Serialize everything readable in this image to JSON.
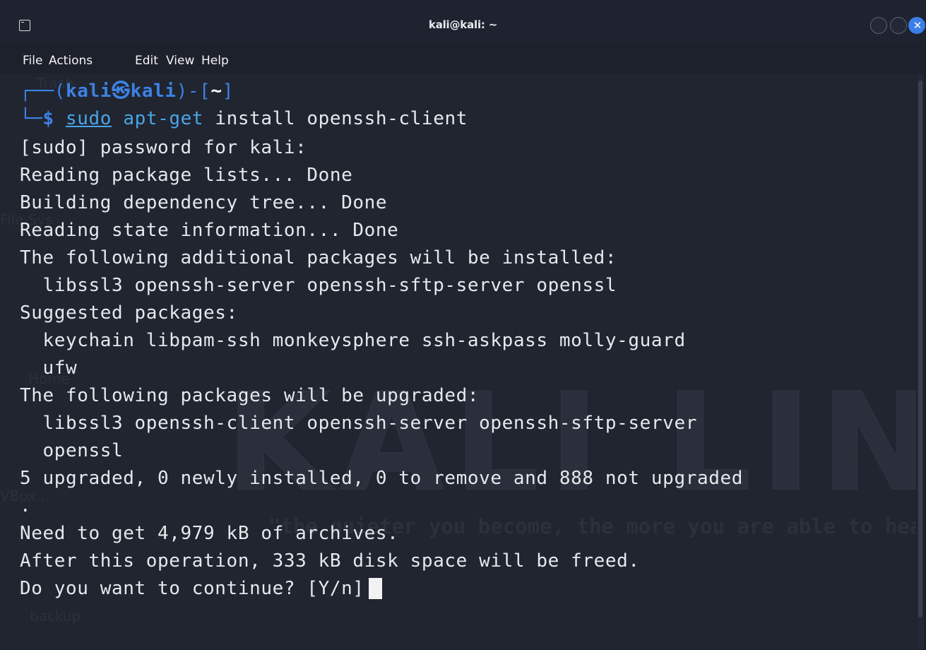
{
  "window": {
    "title": "kali@kali: ~",
    "icon": "terminal-icon",
    "controls": [
      "minimize-icon",
      "maximize-icon",
      "close-icon"
    ],
    "close_glyph": "✕"
  },
  "menu": [
    "File",
    "Actions",
    "Edit",
    "View",
    "Help"
  ],
  "prompt": {
    "top_corner": "┌──(",
    "user": "kali",
    "skull": "㉿",
    "host": "kali",
    "mid": ")-[",
    "path": "~",
    "end": "]",
    "bottom_corner": "└─",
    "symbol": "$",
    "command_sudo": "sudo",
    "command_rest": "apt-get",
    "command_args": "install openssh-client"
  },
  "output": [
    "[sudo] password for kali:",
    "Reading package lists... Done",
    "Building dependency tree... Done",
    "Reading state information... Done",
    "The following additional packages will be installed:",
    "  libssl3 openssh-server openssh-sftp-server openssl",
    "Suggested packages:",
    "  keychain libpam-ssh monkeysphere ssh-askpass molly-guard",
    "  ufw",
    "The following packages will be upgraded:",
    "  libssl3 openssh-client openssh-server openssh-sftp-server",
    "  openssl",
    "5 upgraded, 0 newly installed, 0 to remove and 888 not upgraded",
    ".",
    "Need to get 4,979 kB of archives.",
    "After this operation, 333 kB disk space will be freed.",
    "Do you want to continue? [Y/n]"
  ],
  "background": {
    "logo_text": "KALI LINUX",
    "quote": "\"the quieter you become, the more you are able to hea",
    "desktop_labels": [
      "Trash",
      "File Sys",
      "Home",
      "VBox…",
      "backup"
    ]
  },
  "colors": {
    "prompt_blue": "#3d82e5",
    "command_blue": "#4aa4e6",
    "text": "#e6e8ec",
    "terminal_bg": "#202530",
    "close_button": "#3a7ee8"
  }
}
